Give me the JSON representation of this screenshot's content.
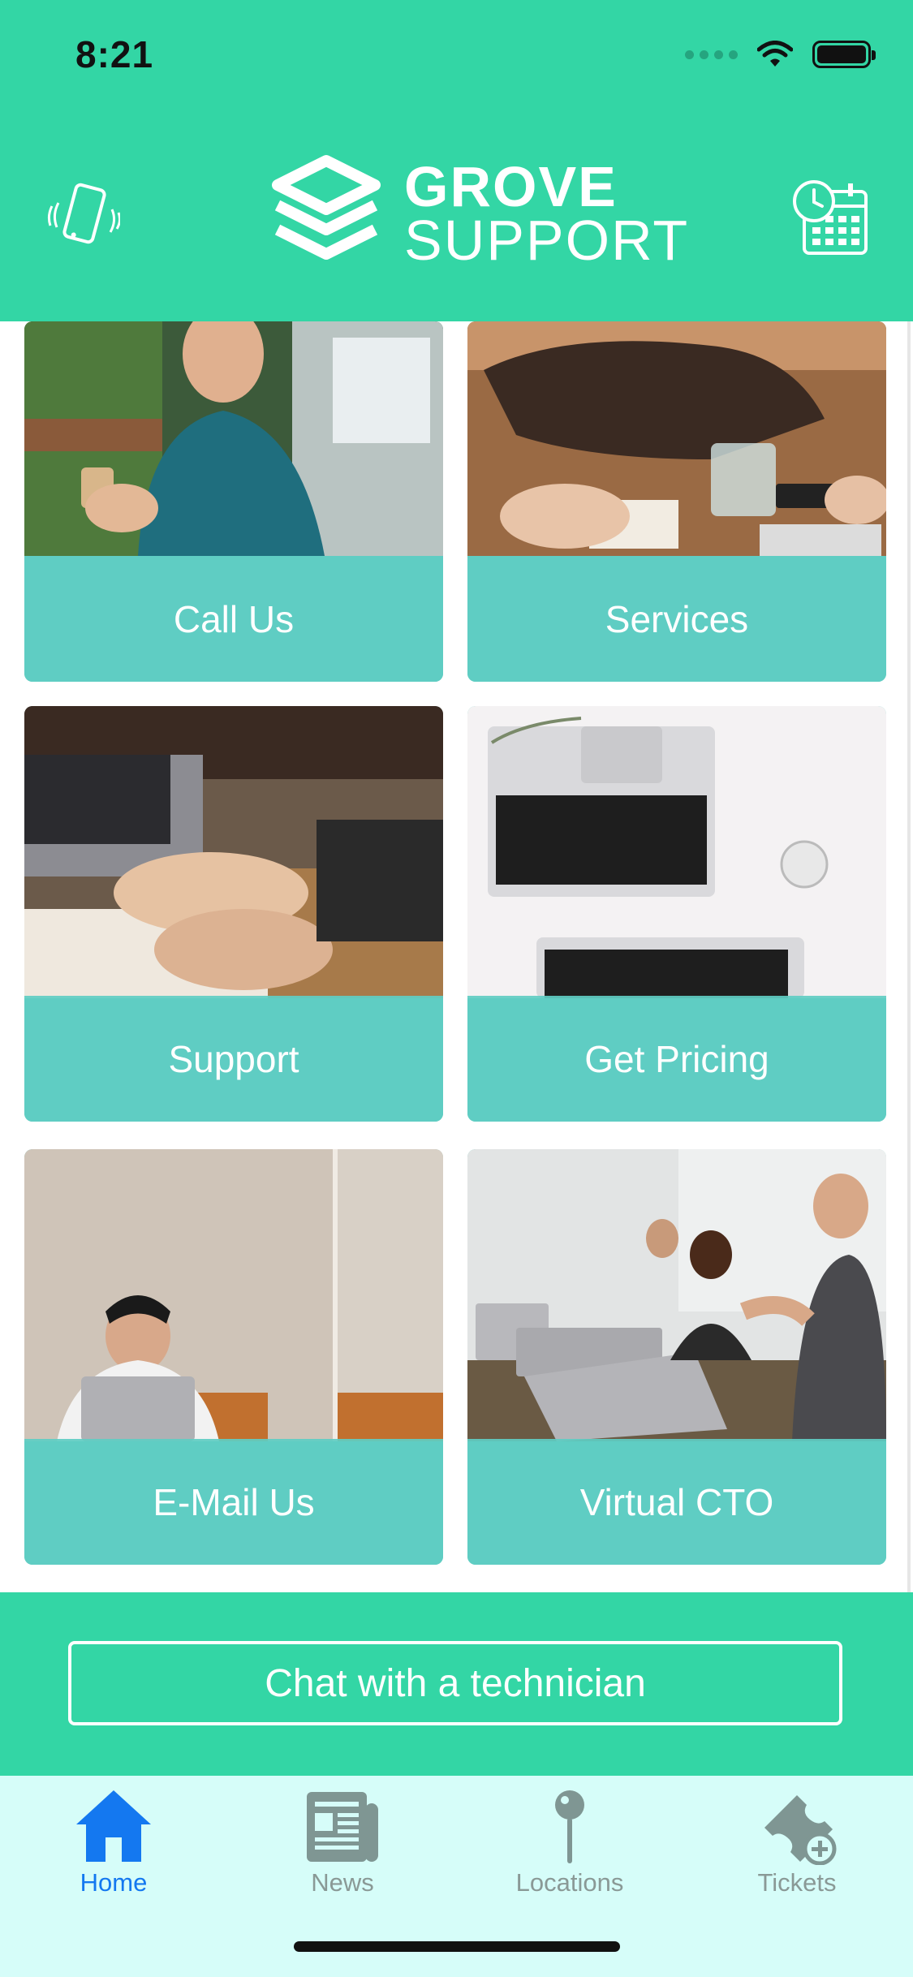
{
  "status_bar": {
    "time": "8:21"
  },
  "header": {
    "brand_line1": "GROVE",
    "brand_line2": "SUPPORT",
    "left_icon": "phone-vibrate-icon",
    "right_icon": "calendar-clock-icon"
  },
  "cards": [
    {
      "label": "Call Us",
      "image": "woman-with-phone-photo"
    },
    {
      "label": "Services",
      "image": "desk-with-bag-photo"
    },
    {
      "label": "Support",
      "image": "hand-writing-photo"
    },
    {
      "label": "Get Pricing",
      "image": "laptops-on-desk-photo"
    },
    {
      "label": "E-Mail Us",
      "image": "stressed-developer-photo"
    },
    {
      "label": "Virtual CTO",
      "image": "team-meeting-photo"
    }
  ],
  "chat_button": {
    "label": "Chat with a technician"
  },
  "tabs": [
    {
      "label": "Home",
      "icon": "home-icon",
      "active": true
    },
    {
      "label": "News",
      "icon": "newspaper-icon",
      "active": false
    },
    {
      "label": "Locations",
      "icon": "map-pin-icon",
      "active": false
    },
    {
      "label": "Tickets",
      "icon": "ticket-add-icon",
      "active": false
    }
  ],
  "colors": {
    "header_bg": "#33d6a5",
    "card_band": "#5fcdc3",
    "tabbar_bg": "#d6fdf9",
    "active_tab": "#1478f0",
    "inactive_tab": "#7f9693"
  }
}
